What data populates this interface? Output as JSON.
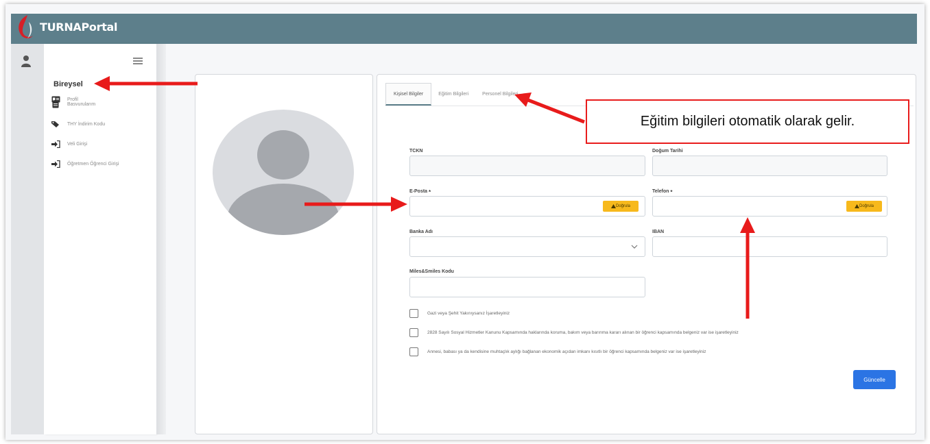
{
  "app": {
    "brand": "TURNAPortal"
  },
  "sidebar": {
    "title": "Bireysel",
    "items": [
      {
        "label": "Profil",
        "icon": "id-card-icon"
      },
      {
        "label": "Basvurularım",
        "icon": "clipboard-icon"
      },
      {
        "label": "THY İndirim Kodu",
        "icon": "tag-icon"
      },
      {
        "label": "Veli Girişi",
        "icon": "sign-in-icon"
      },
      {
        "label": "Öğretmen Öğrenci Girişi",
        "icon": "sign-in-icon"
      }
    ]
  },
  "tabs": [
    {
      "label": "Kişisel Bilgiler",
      "active": true
    },
    {
      "label": "Eğitim Bilgileri",
      "active": false
    },
    {
      "label": "Personel Bilgileri",
      "active": false
    }
  ],
  "form": {
    "tckn": {
      "label": "TCKN",
      "value": ""
    },
    "birth_date": {
      "label": "Doğum Tarihi",
      "value": ""
    },
    "email": {
      "label": "E-Posta",
      "required": "*",
      "value": "",
      "verify": "Doğrula"
    },
    "phone": {
      "label": "Telefon",
      "required": "*",
      "value": "",
      "verify": "Doğrula"
    },
    "bank": {
      "label": "Banka Adı",
      "value": ""
    },
    "iban": {
      "label": "IBAN",
      "value": ""
    },
    "miles": {
      "label": "Miles&Smiles Kodu",
      "value": ""
    },
    "checkboxes": [
      {
        "label": "Gazi veya Şehit Yakınıysanız İşaretleyiniz",
        "checked": false
      },
      {
        "label": "2828 Sayılı Sosyal Hizmetler Kanunu Kapsamında haklarında koruma, bakım veya barınma kararı alınan bir öğrenci kapsamında belgeniz var ise işaretleyiniz",
        "checked": false
      },
      {
        "label": "Annesi, babası ya da kendisine muhtaçlık aylığı bağlanan ekonomik açıdan imkanı kısıtlı bir öğrenci kapsamında belgeniz var ise işaretleyiniz",
        "checked": false
      }
    ],
    "update_button": "Güncelle"
  },
  "annotation": {
    "callout": "Eğitim bilgileri otomatik olarak gelir."
  },
  "colors": {
    "topbar": "#5d7f8b",
    "verify": "#f7b91c",
    "primary": "#2b74e4",
    "annotation": "#e81b1b"
  }
}
